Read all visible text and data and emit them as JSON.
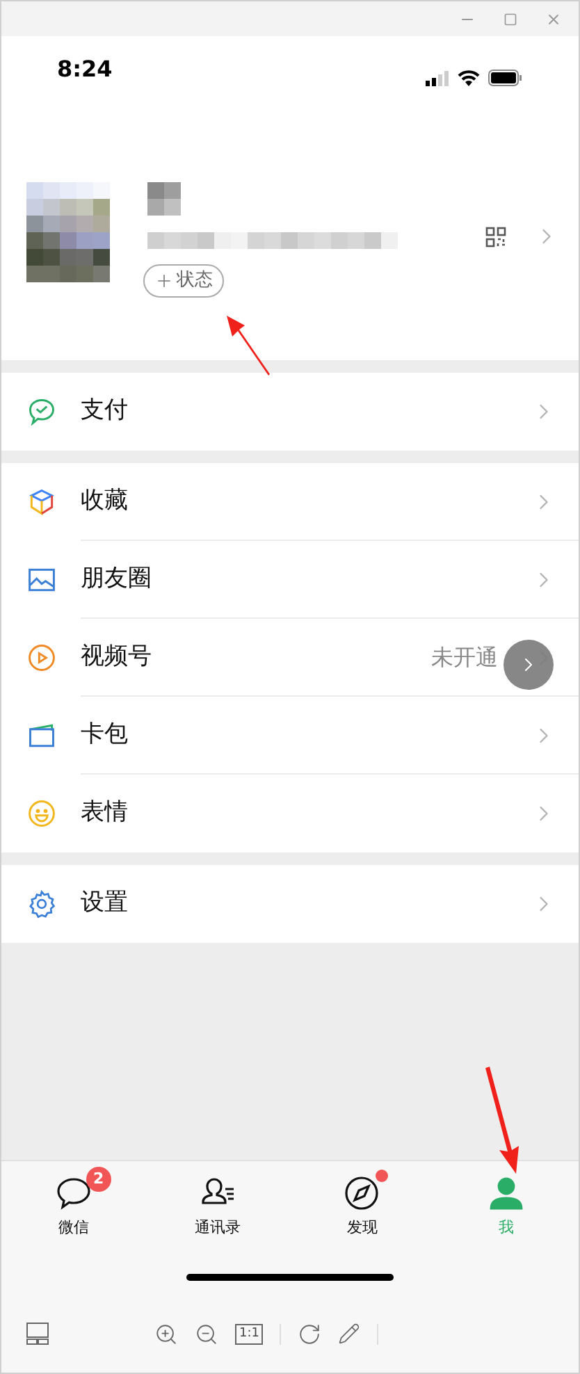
{
  "status_bar": {
    "time": "8:24"
  },
  "profile": {
    "status_button": "状态"
  },
  "menu_groups": [
    [
      {
        "kind": "pay",
        "label": "支付"
      }
    ],
    [
      {
        "kind": "favorites",
        "label": "收藏"
      },
      {
        "kind": "moments",
        "label": "朋友圈"
      },
      {
        "kind": "channels",
        "label": "视频号",
        "value": "未开通"
      },
      {
        "kind": "cards",
        "label": "卡包"
      },
      {
        "kind": "stickers",
        "label": "表情"
      }
    ],
    [
      {
        "kind": "settings",
        "label": "设置"
      }
    ]
  ],
  "tabs": [
    {
      "kind": "chats",
      "label": "微信",
      "selected": false,
      "badge": "2"
    },
    {
      "kind": "contacts",
      "label": "通讯录",
      "selected": false
    },
    {
      "kind": "discover",
      "label": "发现",
      "selected": false,
      "dot": true
    },
    {
      "kind": "me",
      "label": "我",
      "selected": true
    }
  ],
  "viewer_toolbar": {
    "actual_size": "1:1"
  }
}
